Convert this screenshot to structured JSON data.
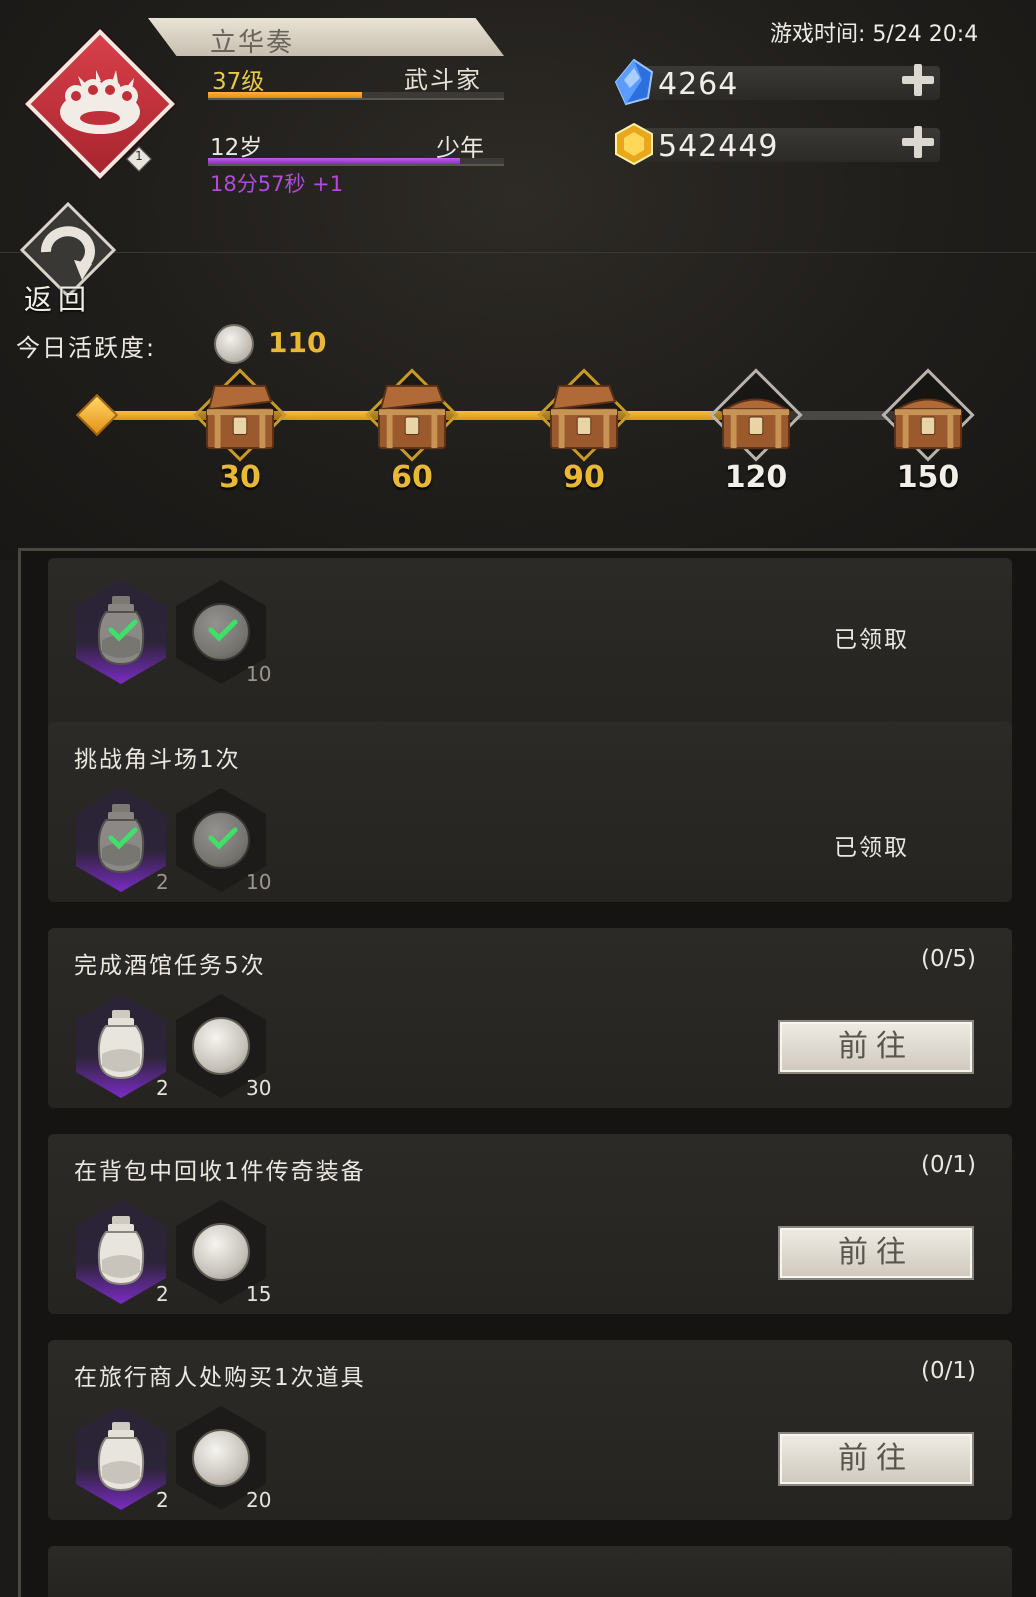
{
  "header": {
    "player_name": "立华奏",
    "level_label": "37级",
    "job_label": "武斗家",
    "level_progress": 0.52,
    "age_label": "12岁",
    "stage_label": "少年",
    "age_progress": 0.85,
    "timer_label": "18分57秒 +1",
    "rank": "1",
    "game_time": "游戏时间: 5/24 20:4",
    "colors": {
      "level": "#e6c84a",
      "timer": "#b04cd8",
      "badge": "#d03a44"
    }
  },
  "currency": {
    "gems": "4264",
    "gold": "542449"
  },
  "nav": {
    "back_label": "返回"
  },
  "activity": {
    "label": "今日活跃度:",
    "value": "110",
    "milestones": [
      "30",
      "60",
      "90",
      "120",
      "150"
    ],
    "opened_count": 3
  },
  "tasks": [
    {
      "title": "",
      "progress": "",
      "rewards": [
        "",
        "10"
      ],
      "status": "已领取",
      "claimed": true
    },
    {
      "title": "挑战角斗场1次",
      "progress": "",
      "rewards": [
        "2",
        "10"
      ],
      "status": "已领取",
      "claimed": true
    },
    {
      "title": "完成酒馆任务5次",
      "progress": "(0/5)",
      "rewards": [
        "2",
        "30"
      ],
      "button": "前往",
      "claimed": false
    },
    {
      "title": "在背包中回收1件传奇装备",
      "progress": "(0/1)",
      "rewards": [
        "2",
        "15"
      ],
      "button": "前往",
      "claimed": false
    },
    {
      "title": "在旅行商人处购买1次道具",
      "progress": "(0/1)",
      "rewards": [
        "2",
        "20"
      ],
      "button": "前往",
      "claimed": false
    }
  ]
}
